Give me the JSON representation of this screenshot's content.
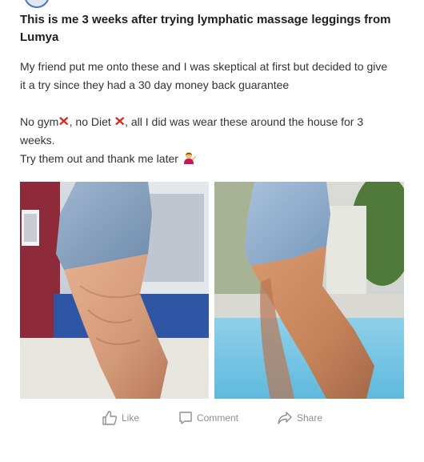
{
  "post": {
    "title": "This is me 3 weeks after trying lymphatic massage leggings from Lumya",
    "paragraph1": "My friend put me onto these and I was skeptical at first but decided to give it a try since they had a 30 day money back guarantee",
    "paragraph2_a": "No gym",
    "paragraph2_b": ", no Diet ",
    "paragraph2_c": ", all I did was wear these around the house for 3 weeks.",
    "paragraph3": "Try them out and thank me later",
    "icons": {
      "cross": "cross-mark-emoji",
      "person": "person-tipping-hand-emoji"
    }
  },
  "photos": {
    "left": "before-photo",
    "right": "after-photo"
  },
  "actions": {
    "like_label": "Like",
    "comment_label": "Comment",
    "share_label": "Share"
  },
  "colors": {
    "text": "#1c1e21",
    "action": "#8e8e8e",
    "cross": "#e0241f"
  }
}
